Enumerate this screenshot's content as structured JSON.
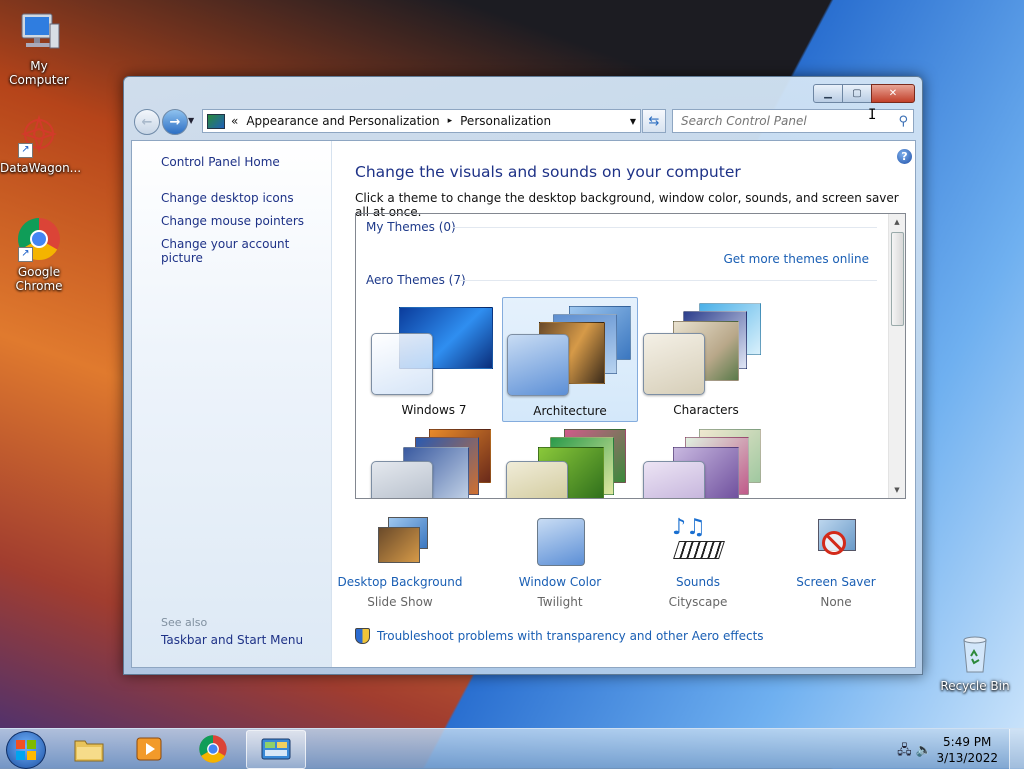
{
  "desktop": {
    "icons": [
      {
        "label": "My Computer"
      },
      {
        "label": "DataWagon..."
      },
      {
        "label": "Google Chrome"
      },
      {
        "label": "Recycle Bin"
      }
    ]
  },
  "window": {
    "address": {
      "chevrons": "«",
      "crumbs": [
        "Appearance and Personalization",
        "Personalization"
      ],
      "separator": "▸"
    },
    "search_placeholder": "Search Control Panel",
    "caption": {
      "minimize": "▁",
      "maximize": "▢",
      "close": "✕"
    }
  },
  "sidebar": {
    "home": "Control Panel Home",
    "links": [
      "Change desktop icons",
      "Change mouse pointers",
      "Change your account picture"
    ],
    "see_also_heading": "See also",
    "see_also_links": [
      "Taskbar and Start Menu"
    ]
  },
  "main": {
    "title": "Change the visuals and sounds on your computer",
    "subtitle": "Click a theme to change the desktop background, window color, sounds, and screen saver all at once.",
    "my_themes": "My Themes (0)",
    "get_more": "Get more themes online",
    "aero_themes": "Aero Themes (7)",
    "themes": [
      {
        "name": "Windows 7",
        "selected": false
      },
      {
        "name": "Architecture",
        "selected": true
      },
      {
        "name": "Characters",
        "selected": false
      },
      {
        "name": "",
        "selected": false
      },
      {
        "name": "",
        "selected": false
      },
      {
        "name": "",
        "selected": false
      }
    ],
    "bottom": [
      {
        "name": "Desktop Background",
        "value": "Slide Show"
      },
      {
        "name": "Window Color",
        "value": "Twilight"
      },
      {
        "name": "Sounds",
        "value": "Cityscape"
      },
      {
        "name": "Screen Saver",
        "value": "None"
      }
    ],
    "troubleshoot": "Troubleshoot problems with transparency and other Aero effects"
  },
  "taskbar": {
    "time": "5:49 PM",
    "date": "3/13/2022"
  }
}
